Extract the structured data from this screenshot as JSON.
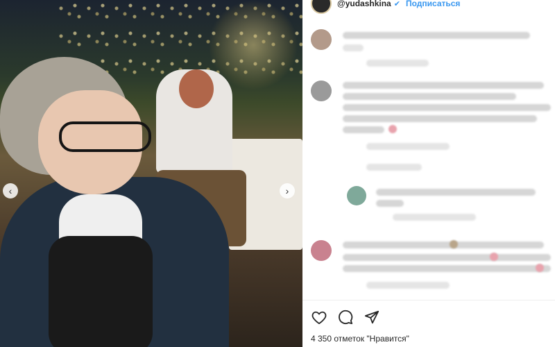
{
  "post": {
    "username": "@yudashkina",
    "verified_icon": "verified-badge-icon",
    "follow_label": "Подписаться"
  },
  "actions": {
    "like_icon": "heart-icon",
    "comment_icon": "comment-icon",
    "share_icon": "send-icon"
  },
  "likes_text": "4 350 отметок \"Нравится\"",
  "nav": {
    "prev_icon": "chevron-left-icon",
    "next_icon": "chevron-right-icon"
  },
  "colors": {
    "link": "#3897f0",
    "text": "#262626"
  }
}
